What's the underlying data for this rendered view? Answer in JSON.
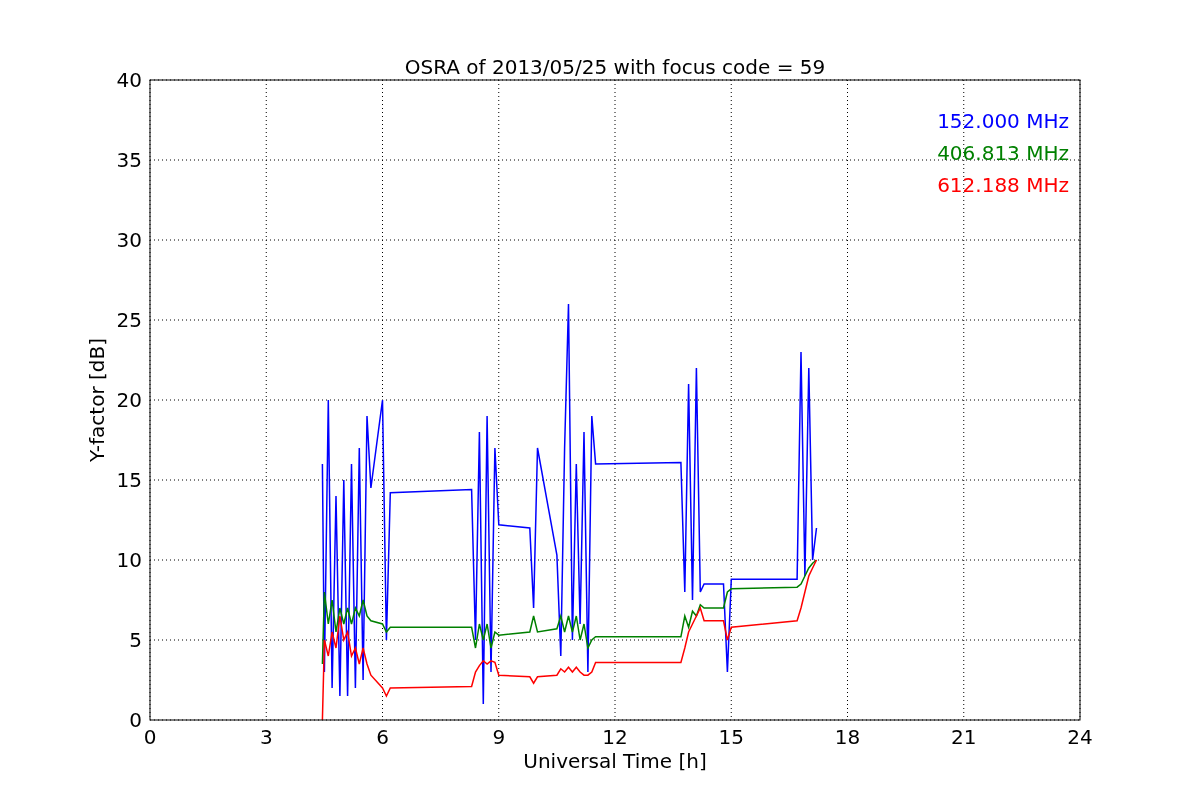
{
  "chart_data": {
    "type": "line",
    "title": "OSRA of 2013/05/25 with focus code = 59",
    "xlabel": "Universal Time [h]",
    "ylabel": "Y-factor [dB]",
    "xlim": [
      0,
      24
    ],
    "ylim": [
      0,
      40
    ],
    "xticks": [
      0,
      3,
      6,
      9,
      12,
      15,
      18,
      21,
      24
    ],
    "yticks": [
      0,
      5,
      10,
      15,
      20,
      25,
      30,
      35,
      40
    ],
    "grid": true,
    "x": [
      4.45,
      4.5,
      4.6,
      4.7,
      4.8,
      4.9,
      5.0,
      5.1,
      5.2,
      5.3,
      5.4,
      5.5,
      5.6,
      5.7,
      6.0,
      6.1,
      6.2,
      8.3,
      8.4,
      8.5,
      8.6,
      8.7,
      8.8,
      8.9,
      9.0,
      9.8,
      9.9,
      10.0,
      10.5,
      10.6,
      10.7,
      10.8,
      10.9,
      11.0,
      11.1,
      11.2,
      11.3,
      11.4,
      11.5,
      13.7,
      13.8,
      13.9,
      14.0,
      14.1,
      14.2,
      14.3,
      14.8,
      14.9,
      15.0,
      16.7,
      16.8,
      16.9,
      17.0,
      17.1,
      17.2
    ],
    "series": [
      {
        "name": "152.000 MHz",
        "color": "#0000ff",
        "values": [
          16,
          3,
          20,
          2,
          14,
          1.5,
          15,
          1.5,
          16,
          2,
          17,
          2.5,
          19,
          14.5,
          20,
          5,
          14.2,
          14.4,
          5,
          18,
          1,
          19,
          3,
          17,
          12.2,
          12,
          7,
          17,
          10.3,
          4,
          17,
          26,
          5,
          16,
          6,
          18,
          3,
          19,
          16,
          16.1,
          8,
          21,
          7.5,
          22,
          8,
          8.5,
          8.5,
          3,
          8.8,
          8.8,
          23,
          9,
          22,
          10,
          12
        ]
      },
      {
        "name": "406.813 MHz",
        "color": "#008000",
        "values": [
          3.5,
          8,
          6,
          7.5,
          5.5,
          7,
          6,
          7,
          6,
          7,
          6.5,
          7.5,
          6.5,
          6.2,
          6,
          5.5,
          5.8,
          5.8,
          4.5,
          6,
          5,
          6,
          4.5,
          5.5,
          5.3,
          5.5,
          6.5,
          5.5,
          5.7,
          6.5,
          5.5,
          6.5,
          5.5,
          6.5,
          5,
          6,
          4.5,
          5,
          5.2,
          5.2,
          6.5,
          5.8,
          6.8,
          6.5,
          7.2,
          7,
          7,
          8,
          8.2,
          8.3,
          8.5,
          9,
          9.5,
          9.8,
          10
        ]
      },
      {
        "name": "612.188 MHz",
        "color": "#ff0000",
        "values": [
          0,
          5,
          4,
          5.5,
          4.5,
          6.5,
          5,
          5.5,
          4,
          4.5,
          3.5,
          4.5,
          3.5,
          2.8,
          2,
          1.5,
          2,
          2.1,
          3,
          3.4,
          3.7,
          3.5,
          3.7,
          3.6,
          2.8,
          2.7,
          2.3,
          2.7,
          2.8,
          3.2,
          3,
          3.3,
          3,
          3.3,
          3,
          2.8,
          2.8,
          3,
          3.6,
          3.6,
          4.5,
          5.5,
          6,
          6.5,
          7,
          6.2,
          6.2,
          5,
          5.8,
          6.2,
          7,
          8,
          9,
          9.5,
          10
        ]
      }
    ]
  }
}
